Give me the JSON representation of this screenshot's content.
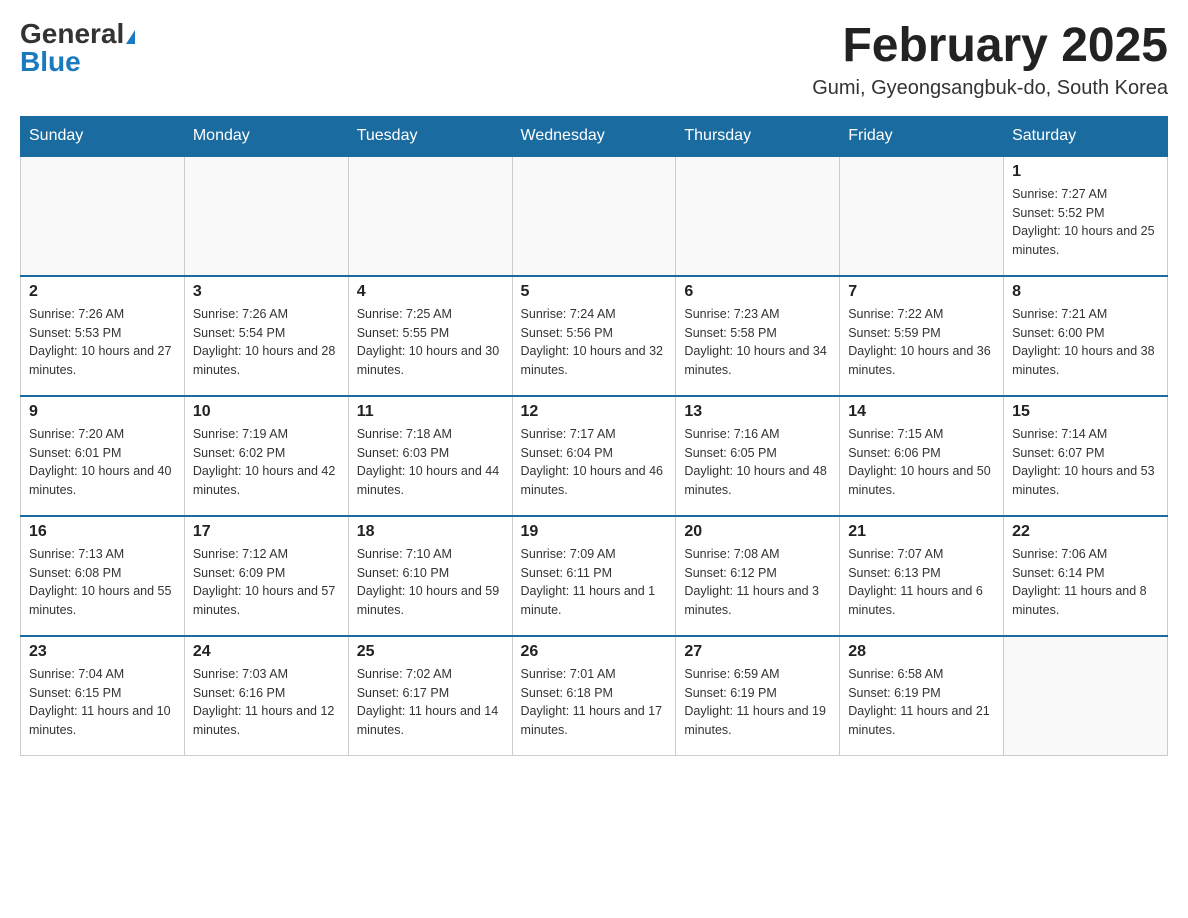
{
  "logo": {
    "general": "General",
    "blue": "Blue"
  },
  "title": "February 2025",
  "location": "Gumi, Gyeongsangbuk-do, South Korea",
  "days_of_week": [
    "Sunday",
    "Monday",
    "Tuesday",
    "Wednesday",
    "Thursday",
    "Friday",
    "Saturday"
  ],
  "weeks": [
    [
      {
        "day": "",
        "info": ""
      },
      {
        "day": "",
        "info": ""
      },
      {
        "day": "",
        "info": ""
      },
      {
        "day": "",
        "info": ""
      },
      {
        "day": "",
        "info": ""
      },
      {
        "day": "",
        "info": ""
      },
      {
        "day": "1",
        "info": "Sunrise: 7:27 AM\nSunset: 5:52 PM\nDaylight: 10 hours and 25 minutes."
      }
    ],
    [
      {
        "day": "2",
        "info": "Sunrise: 7:26 AM\nSunset: 5:53 PM\nDaylight: 10 hours and 27 minutes."
      },
      {
        "day": "3",
        "info": "Sunrise: 7:26 AM\nSunset: 5:54 PM\nDaylight: 10 hours and 28 minutes."
      },
      {
        "day": "4",
        "info": "Sunrise: 7:25 AM\nSunset: 5:55 PM\nDaylight: 10 hours and 30 minutes."
      },
      {
        "day": "5",
        "info": "Sunrise: 7:24 AM\nSunset: 5:56 PM\nDaylight: 10 hours and 32 minutes."
      },
      {
        "day": "6",
        "info": "Sunrise: 7:23 AM\nSunset: 5:58 PM\nDaylight: 10 hours and 34 minutes."
      },
      {
        "day": "7",
        "info": "Sunrise: 7:22 AM\nSunset: 5:59 PM\nDaylight: 10 hours and 36 minutes."
      },
      {
        "day": "8",
        "info": "Sunrise: 7:21 AM\nSunset: 6:00 PM\nDaylight: 10 hours and 38 minutes."
      }
    ],
    [
      {
        "day": "9",
        "info": "Sunrise: 7:20 AM\nSunset: 6:01 PM\nDaylight: 10 hours and 40 minutes."
      },
      {
        "day": "10",
        "info": "Sunrise: 7:19 AM\nSunset: 6:02 PM\nDaylight: 10 hours and 42 minutes."
      },
      {
        "day": "11",
        "info": "Sunrise: 7:18 AM\nSunset: 6:03 PM\nDaylight: 10 hours and 44 minutes."
      },
      {
        "day": "12",
        "info": "Sunrise: 7:17 AM\nSunset: 6:04 PM\nDaylight: 10 hours and 46 minutes."
      },
      {
        "day": "13",
        "info": "Sunrise: 7:16 AM\nSunset: 6:05 PM\nDaylight: 10 hours and 48 minutes."
      },
      {
        "day": "14",
        "info": "Sunrise: 7:15 AM\nSunset: 6:06 PM\nDaylight: 10 hours and 50 minutes."
      },
      {
        "day": "15",
        "info": "Sunrise: 7:14 AM\nSunset: 6:07 PM\nDaylight: 10 hours and 53 minutes."
      }
    ],
    [
      {
        "day": "16",
        "info": "Sunrise: 7:13 AM\nSunset: 6:08 PM\nDaylight: 10 hours and 55 minutes."
      },
      {
        "day": "17",
        "info": "Sunrise: 7:12 AM\nSunset: 6:09 PM\nDaylight: 10 hours and 57 minutes."
      },
      {
        "day": "18",
        "info": "Sunrise: 7:10 AM\nSunset: 6:10 PM\nDaylight: 10 hours and 59 minutes."
      },
      {
        "day": "19",
        "info": "Sunrise: 7:09 AM\nSunset: 6:11 PM\nDaylight: 11 hours and 1 minute."
      },
      {
        "day": "20",
        "info": "Sunrise: 7:08 AM\nSunset: 6:12 PM\nDaylight: 11 hours and 3 minutes."
      },
      {
        "day": "21",
        "info": "Sunrise: 7:07 AM\nSunset: 6:13 PM\nDaylight: 11 hours and 6 minutes."
      },
      {
        "day": "22",
        "info": "Sunrise: 7:06 AM\nSunset: 6:14 PM\nDaylight: 11 hours and 8 minutes."
      }
    ],
    [
      {
        "day": "23",
        "info": "Sunrise: 7:04 AM\nSunset: 6:15 PM\nDaylight: 11 hours and 10 minutes."
      },
      {
        "day": "24",
        "info": "Sunrise: 7:03 AM\nSunset: 6:16 PM\nDaylight: 11 hours and 12 minutes."
      },
      {
        "day": "25",
        "info": "Sunrise: 7:02 AM\nSunset: 6:17 PM\nDaylight: 11 hours and 14 minutes."
      },
      {
        "day": "26",
        "info": "Sunrise: 7:01 AM\nSunset: 6:18 PM\nDaylight: 11 hours and 17 minutes."
      },
      {
        "day": "27",
        "info": "Sunrise: 6:59 AM\nSunset: 6:19 PM\nDaylight: 11 hours and 19 minutes."
      },
      {
        "day": "28",
        "info": "Sunrise: 6:58 AM\nSunset: 6:19 PM\nDaylight: 11 hours and 21 minutes."
      },
      {
        "day": "",
        "info": ""
      }
    ]
  ]
}
